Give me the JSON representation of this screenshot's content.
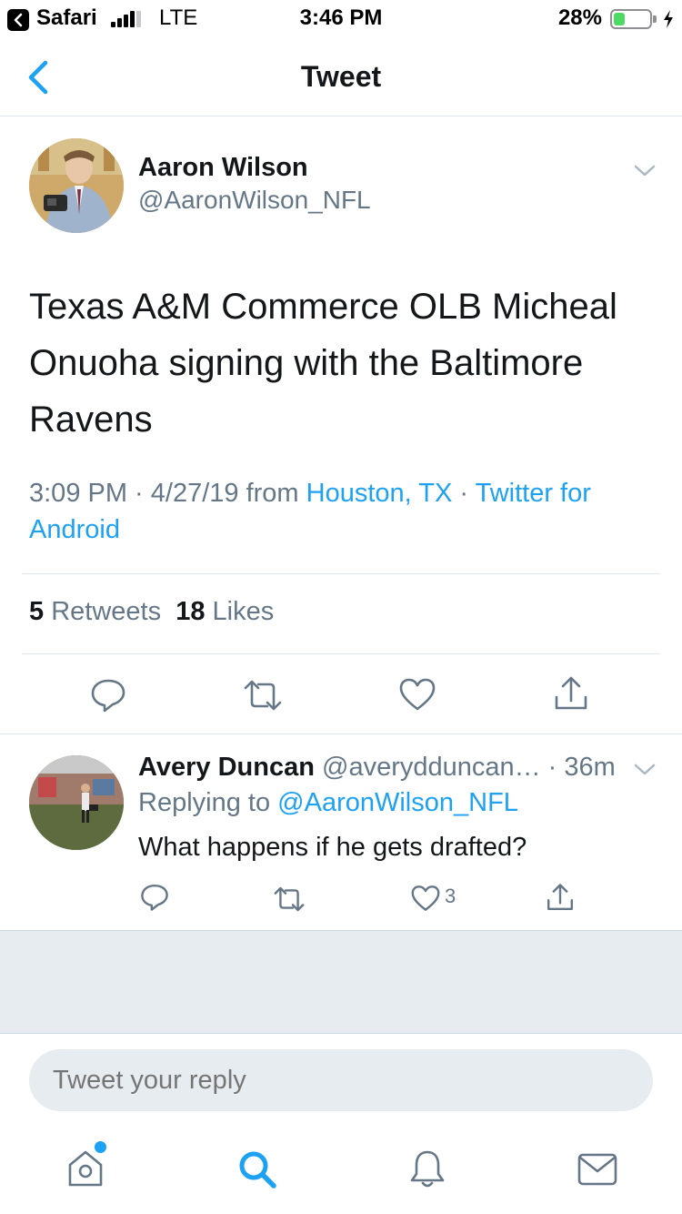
{
  "status_bar": {
    "back_app": "Safari",
    "network": "LTE",
    "time": "3:46 PM",
    "battery_percent": "28%",
    "battery_level": 0.28
  },
  "nav": {
    "title": "Tweet"
  },
  "tweet": {
    "author_name": "Aaron Wilson",
    "author_handle": "@AaronWilson_NFL",
    "text": "Texas A&M Commerce OLB Micheal Onuoha signing with the Baltimore Ravens",
    "time": "3:09 PM · 4/27/19",
    "from_label": " from ",
    "location": "Houston, TX",
    "separator": " · ",
    "source": "Twitter for Android",
    "retweets_count": "5",
    "retweets_label": " Retweets",
    "likes_count": "18",
    "likes_label": " Likes"
  },
  "reply": {
    "author_name": "Avery Duncan",
    "author_handle": "@averydduncan…",
    "time": " · 36m",
    "replying_prefix": "Replying to ",
    "replying_to": "@AaronWilson_NFL",
    "text": "What happens if he gets drafted?",
    "like_count": "3"
  },
  "composer": {
    "placeholder": "Tweet your reply"
  },
  "icons": {
    "colors": {
      "accent": "#1da1f2",
      "icon_gray": "#657786",
      "text": "#14171a"
    }
  }
}
